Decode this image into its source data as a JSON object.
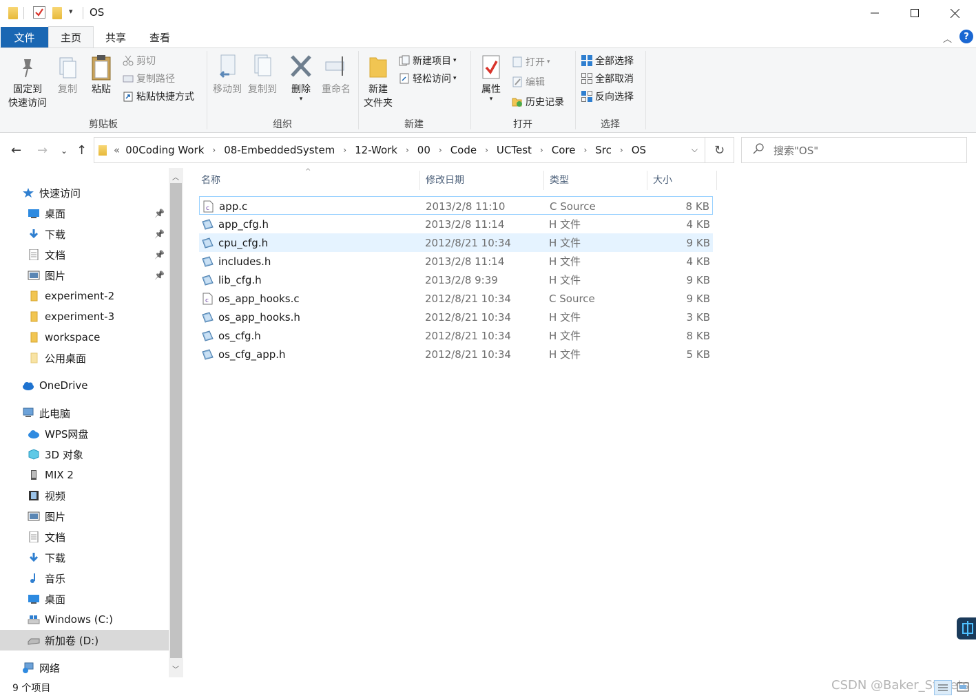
{
  "window": {
    "title": "OS"
  },
  "tabs": {
    "file": "文件",
    "home": "主页",
    "share": "共享",
    "view": "查看"
  },
  "ribbon": {
    "clipboard": {
      "label": "剪贴板",
      "pin_line1": "固定到",
      "pin_line2": "快速访问",
      "copy": "复制",
      "paste": "粘贴",
      "cut": "剪切",
      "copy_path": "复制路径",
      "paste_shortcut": "粘贴快捷方式"
    },
    "organize": {
      "label": "组织",
      "move_to": "移动到",
      "copy_to": "复制到",
      "delete": "删除",
      "rename": "重命名"
    },
    "new": {
      "label": "新建",
      "new_item": "新建项目",
      "easy_access": "轻松访问",
      "new_folder_line1": "新建",
      "new_folder_line2": "文件夹"
    },
    "open": {
      "label": "打开",
      "properties": "属性",
      "open": "打开",
      "edit": "编辑",
      "history": "历史记录"
    },
    "select": {
      "label": "选择",
      "select_all": "全部选择",
      "select_none": "全部取消",
      "invert": "反向选择"
    }
  },
  "address": {
    "overflow": "«",
    "crumbs": [
      "00Coding Work",
      "08-EmbeddedSystem",
      "12-Work",
      "00",
      "Code",
      "UCTest",
      "Core",
      "Src",
      "OS"
    ]
  },
  "search": {
    "placeholder": "搜索\"OS\""
  },
  "nav": {
    "quick_access": "快速访问",
    "qa_items": [
      "桌面",
      "下载",
      "文档",
      "图片",
      "experiment-2",
      "experiment-3",
      "workspace",
      "公用桌面"
    ],
    "onedrive": "OneDrive",
    "this_pc": "此电脑",
    "pc_items": [
      "WPS网盘",
      "3D 对象",
      "MIX 2",
      "视频",
      "图片",
      "文档",
      "下载",
      "音乐",
      "桌面",
      "Windows (C:)",
      "新加卷 (D:)"
    ],
    "network": "网络"
  },
  "columns": {
    "name": "名称",
    "date": "修改日期",
    "type": "类型",
    "size": "大小"
  },
  "files": [
    {
      "name": "app.c",
      "date": "2013/2/8 11:10",
      "type": "C Source",
      "size": "8 KB",
      "icon": "c-source-icon"
    },
    {
      "name": "app_cfg.h",
      "date": "2013/2/8 11:14",
      "type": "H 文件",
      "size": "4 KB",
      "icon": "h-file-icon"
    },
    {
      "name": "cpu_cfg.h",
      "date": "2012/8/21 10:34",
      "type": "H 文件",
      "size": "9 KB",
      "icon": "h-file-icon"
    },
    {
      "name": "includes.h",
      "date": "2013/2/8 11:14",
      "type": "H 文件",
      "size": "4 KB",
      "icon": "h-file-icon"
    },
    {
      "name": "lib_cfg.h",
      "date": "2013/2/8 9:39",
      "type": "H 文件",
      "size": "9 KB",
      "icon": "h-file-icon"
    },
    {
      "name": "os_app_hooks.c",
      "date": "2012/8/21 10:34",
      "type": "C Source",
      "size": "9 KB",
      "icon": "c-source-icon"
    },
    {
      "name": "os_app_hooks.h",
      "date": "2012/8/21 10:34",
      "type": "H 文件",
      "size": "3 KB",
      "icon": "h-file-icon"
    },
    {
      "name": "os_cfg.h",
      "date": "2012/8/21 10:34",
      "type": "H 文件",
      "size": "8 KB",
      "icon": "h-file-icon"
    },
    {
      "name": "os_cfg_app.h",
      "date": "2012/8/21 10:34",
      "type": "H 文件",
      "size": "5 KB",
      "icon": "h-file-icon"
    }
  ],
  "status": {
    "count": "9 个项目"
  },
  "watermark": "CSDN @Baker_Streets"
}
